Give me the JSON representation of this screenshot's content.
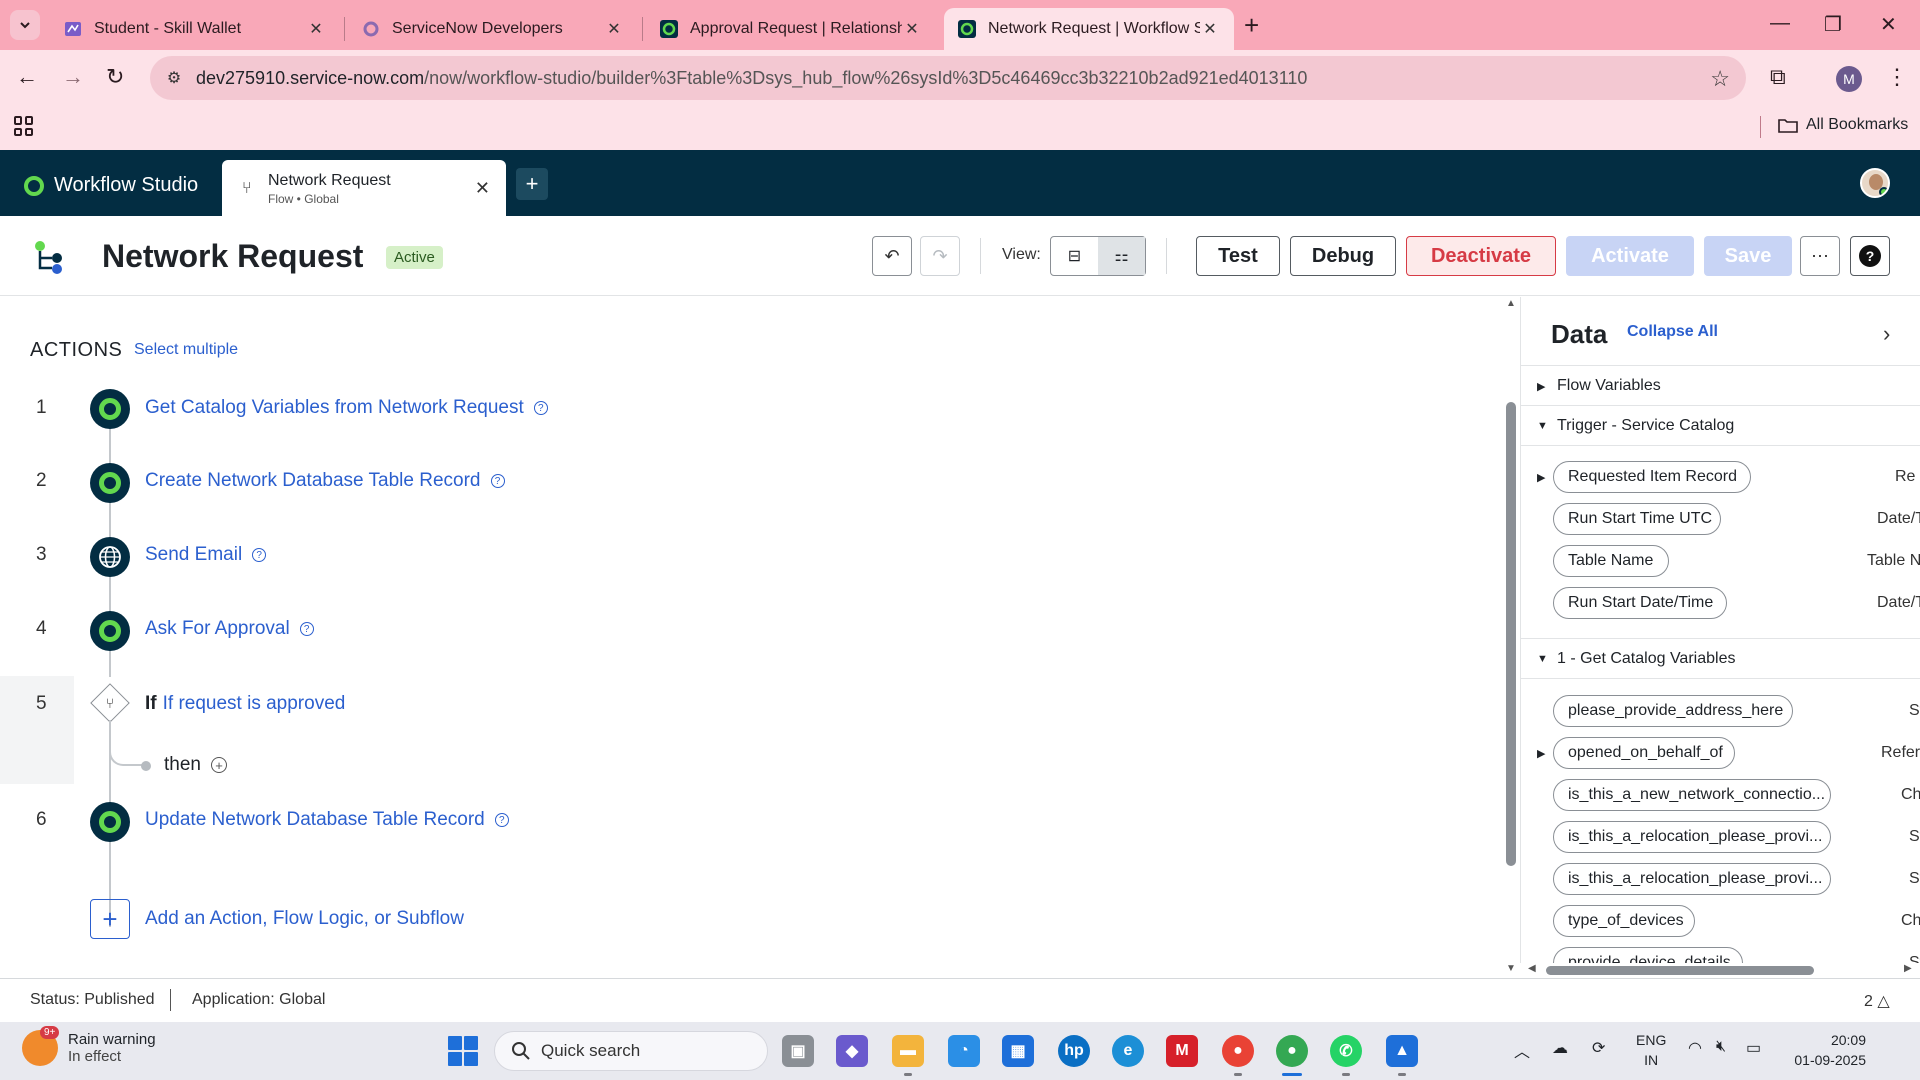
{
  "browser": {
    "tabs": [
      {
        "title": "Student - Skill Wallet"
      },
      {
        "title": "ServiceNow Developers"
      },
      {
        "title": "Approval Request | Relationship"
      },
      {
        "title": "Network Request | Workflow Stu"
      }
    ],
    "url_host": "dev275910.service-now.com",
    "url_path": "/now/workflow-studio/builder%3Ftable%3Dsys_hub_flow%26sysId%3D5c46469cc3b32210b2ad921ed4013110",
    "profile_initial": "M",
    "bookmarks_label": "All Bookmarks"
  },
  "app": {
    "name": "Workflow Studio",
    "tab_title": "Network Request",
    "tab_subtitle": "Flow • Global"
  },
  "flow": {
    "title": "Network Request",
    "status_badge": "Active",
    "view_label": "View:",
    "buttons": {
      "test": "Test",
      "debug": "Debug",
      "deactivate": "Deactivate",
      "activate": "Activate",
      "save": "Save"
    }
  },
  "actions": {
    "heading": "ACTIONS",
    "select_multiple": "Select multiple",
    "steps": [
      {
        "num": "1",
        "label": "Get Catalog Variables from Network Request"
      },
      {
        "num": "2",
        "label": "Create Network Database Table Record"
      },
      {
        "num": "3",
        "label": "Send Email"
      },
      {
        "num": "4",
        "label": "Ask For Approval"
      },
      {
        "num": "5",
        "keyword": "If",
        "label": "If request is approved",
        "then": "then"
      },
      {
        "num": "6",
        "label": "Update Network Database Table Record"
      }
    ],
    "add_label": "Add an Action, Flow Logic, or Subflow"
  },
  "data_panel": {
    "title": "Data",
    "collapse_all": "Collapse All",
    "flow_variables": "Flow Variables",
    "trigger_section": "Trigger - Service Catalog",
    "trigger_pills": [
      {
        "label": "Requested Item Record",
        "type": "Re"
      },
      {
        "label": "Run Start Time UTC",
        "type": "Date/T"
      },
      {
        "label": "Table Name",
        "type": "Table N"
      },
      {
        "label": "Run Start Date/Time",
        "type": "Date/T"
      }
    ],
    "catalog_section": "1 - Get Catalog Variables",
    "catalog_pills": [
      {
        "label": "please_provide_address_here",
        "type": "St"
      },
      {
        "label": "opened_on_behalf_of",
        "type": "Refere"
      },
      {
        "label": "is_this_a_new_network_connectio...",
        "type": "Ch"
      },
      {
        "label": "is_this_a_relocation_please_provi...",
        "type": "St"
      },
      {
        "label": "is_this_a_relocation_please_provi...",
        "type": "St"
      },
      {
        "label": "type_of_devices",
        "type": "Ch"
      },
      {
        "label": "provide_device_details",
        "type": "St"
      }
    ]
  },
  "statusbar": {
    "status": "Status: Published",
    "application": "Application: Global",
    "notifications": "2"
  },
  "taskbar": {
    "weather_title": "Rain warning",
    "weather_sub": "In effect",
    "weather_badge": "9+",
    "search_placeholder": "Quick search",
    "lang_top": "ENG",
    "lang_bottom": "IN",
    "time": "20:09",
    "date": "01-09-2025"
  }
}
